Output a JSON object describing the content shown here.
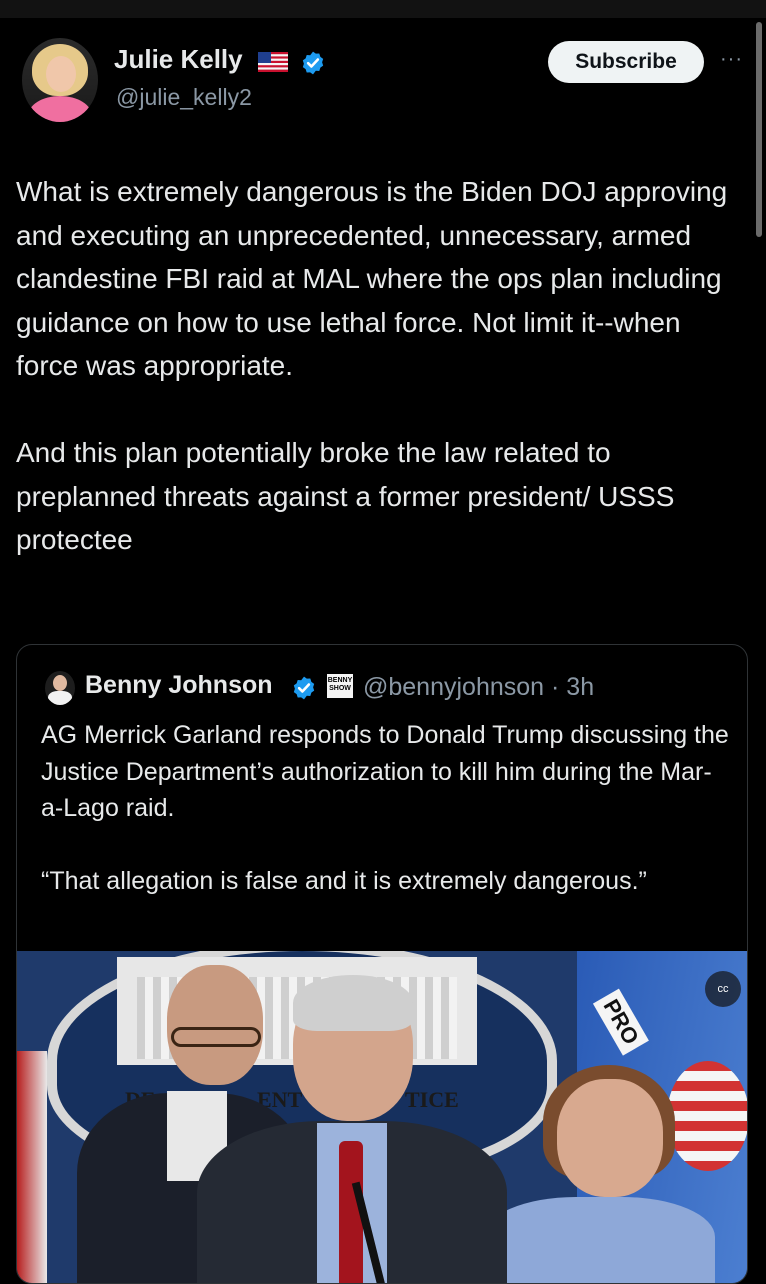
{
  "post": {
    "author_name": "Julie Kelly",
    "handle": "@julie_kelly2",
    "subscribe_label": "Subscribe",
    "more_label": "···",
    "paragraphs": [
      "What is extremely dangerous is the Biden DOJ approving and executing an unprecedented, unnecessary, armed clandestine FBI raid at MAL where the ops plan including guidance on how to use lethal force. Not limit it--when force was appropriate.",
      "And this plan potentially broke the law related to preplanned threats against a former president/ USSS protectee"
    ]
  },
  "quote": {
    "author_name": "Benny Johnson",
    "badge_text": "BENNY SHOW",
    "meta": "@bennyjohnson · 3h",
    "paragraphs": [
      "AG Merrick Garland responds to Donald Trump discussing the Justice Department’s authorization to kill him during the Mar-a-Lago raid.",
      "“That allegation is false and it is extremely dangerous.”"
    ],
    "media": {
      "seal_fragments": [
        "DE",
        "ENT",
        "TICE"
      ],
      "flag_text": "PRO",
      "cc_label": "cc"
    }
  },
  "icons": {
    "verified": "verified-badge-icon",
    "flag": "us-flag-icon",
    "more": "more-options-icon"
  },
  "colors": {
    "background": "#000000",
    "text": "#e7e9ea",
    "secondary": "#8b98a5",
    "verified_blue": "#1d9bf0",
    "button_bg": "#eff3f4"
  }
}
